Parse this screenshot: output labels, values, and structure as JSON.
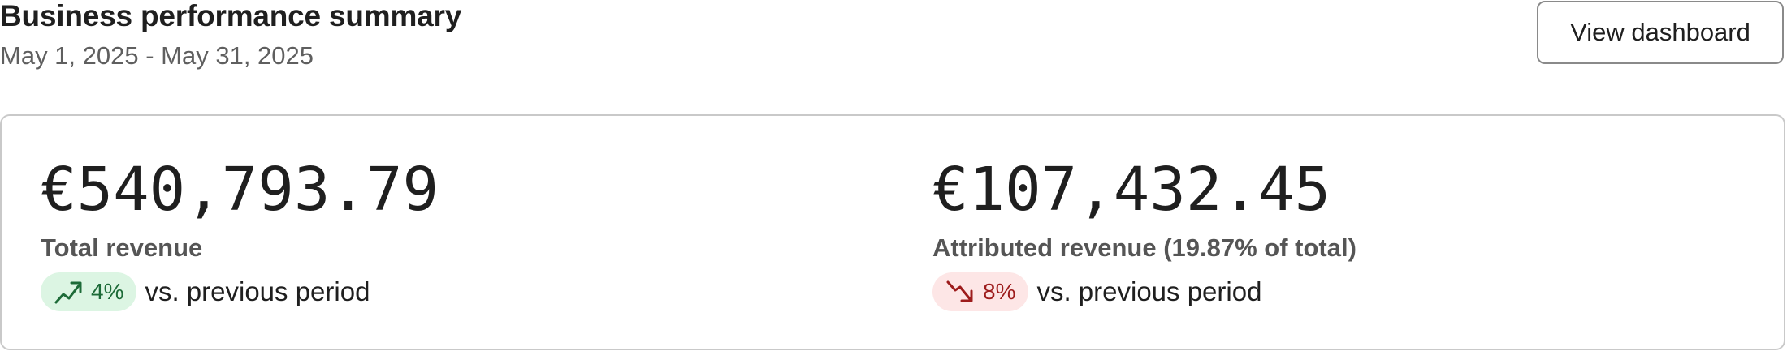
{
  "header": {
    "title": "Business performance summary",
    "date_range": "May 1, 2025 - May 31, 2025",
    "view_button_label": "View dashboard"
  },
  "metrics": [
    {
      "value": "€540,793.79",
      "label": "Total revenue",
      "change": "4%",
      "direction": "up",
      "icon": "trend-up-icon",
      "comparison": "vs. previous period"
    },
    {
      "value": "€107,432.45",
      "label": "Attributed revenue (19.87% of total)",
      "change": "8%",
      "direction": "down",
      "icon": "trend-down-icon",
      "comparison": "vs. previous period"
    }
  ],
  "colors": {
    "positive_bg": "#dcf5e3",
    "positive_fg": "#1d6b38",
    "negative_bg": "#fde6e6",
    "negative_fg": "#9d1c1c"
  }
}
